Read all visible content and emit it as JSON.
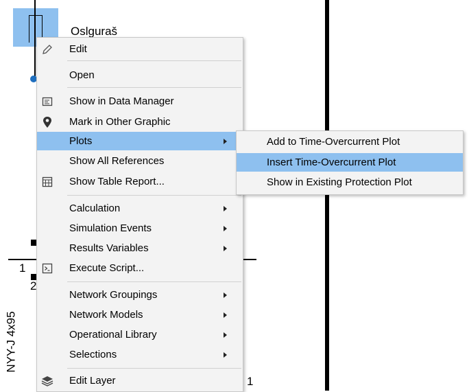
{
  "diagram": {
    "element_name": "Oslguraš",
    "bus_label_left": "1",
    "bus_label_2": "2",
    "cable_label": "NYY-J 4x95",
    "bus_label_right": "1"
  },
  "context_menu": {
    "items": [
      {
        "label": "Edit",
        "icon": "pencil-icon"
      },
      {
        "label": "Open",
        "icon": ""
      },
      {
        "label": "Show in Data Manager",
        "icon": "data-manager-icon"
      },
      {
        "label": "Mark in Other Graphic",
        "icon": "map-pin-icon"
      },
      {
        "label": "Plots",
        "icon": "",
        "submenu": true,
        "active": true
      },
      {
        "label": "Show All References",
        "icon": ""
      },
      {
        "label": "Show Table Report...",
        "icon": "table-report-icon"
      },
      {
        "label": "Calculation",
        "icon": "",
        "submenu": true
      },
      {
        "label": "Simulation Events",
        "icon": "",
        "submenu": true
      },
      {
        "label": "Results Variables",
        "icon": "",
        "submenu": true
      },
      {
        "label": "Execute Script...",
        "icon": "script-icon"
      },
      {
        "label": "Network Groupings",
        "icon": "",
        "submenu": true
      },
      {
        "label": "Network Models",
        "icon": "",
        "submenu": true
      },
      {
        "label": "Operational Library",
        "icon": "",
        "submenu": true
      },
      {
        "label": "Selections",
        "icon": "",
        "submenu": true
      },
      {
        "label": "Edit Layer",
        "icon": "layers-icon"
      }
    ]
  },
  "plots_submenu": {
    "items": [
      {
        "label": "Add to Time-Overcurrent Plot"
      },
      {
        "label": "Insert Time-Overcurrent Plot",
        "active": true
      },
      {
        "label": "Show in Existing Protection Plot"
      }
    ]
  },
  "colors": {
    "highlight": "#8ec0ef",
    "menu_bg": "#f3f3f3",
    "node": "#1f6fbf"
  }
}
